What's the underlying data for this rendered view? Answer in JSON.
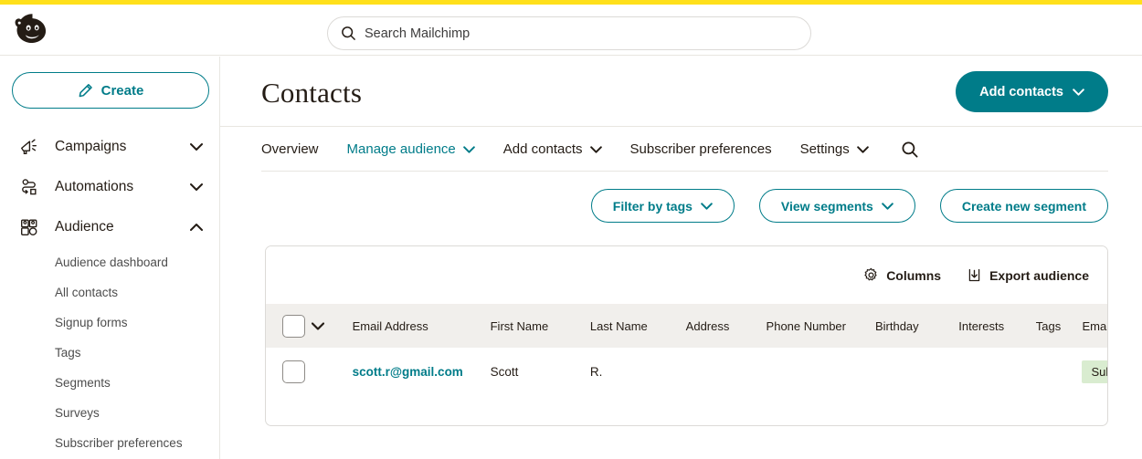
{
  "brand": {
    "logo_icon": "mailchimp-freddie-logo",
    "accent_color": "#007c89",
    "yellow_color": "#ffe01b",
    "badge_color": "#d9ecd0"
  },
  "header": {
    "search": {
      "icon": "search-icon",
      "placeholder": "Search Mailchimp",
      "value": ""
    }
  },
  "sidebar": {
    "create_button": {
      "label": "Create",
      "icon": "pencil-icon"
    },
    "nav": [
      {
        "label": "Campaigns",
        "icon": "megaphone-icon",
        "caret": "chevron-down-icon",
        "expanded": false
      },
      {
        "label": "Automations",
        "icon": "automation-flow-icon",
        "caret": "chevron-down-icon",
        "expanded": false
      },
      {
        "label": "Audience",
        "icon": "audience-people-icon",
        "caret": "chevron-up-icon",
        "expanded": true
      }
    ],
    "audience_subitems": [
      {
        "label": "Audience dashboard"
      },
      {
        "label": "All contacts"
      },
      {
        "label": "Signup forms"
      },
      {
        "label": "Tags"
      },
      {
        "label": "Segments"
      },
      {
        "label": "Surveys"
      },
      {
        "label": "Subscriber preferences"
      }
    ]
  },
  "page": {
    "title": "Contacts",
    "add_contacts_button": {
      "label": "Add contacts",
      "caret": "chevron-down-icon"
    }
  },
  "tabs": [
    {
      "label": "Overview",
      "active": false,
      "caret": null
    },
    {
      "label": "Manage audience",
      "active": true,
      "caret": "chevron-down-icon"
    },
    {
      "label": "Add contacts",
      "active": false,
      "caret": "chevron-down-icon"
    },
    {
      "label": "Subscriber preferences",
      "active": false,
      "caret": null
    },
    {
      "label": "Settings",
      "active": false,
      "caret": "chevron-down-icon"
    }
  ],
  "tab_search_icon": "search-icon",
  "filters": [
    {
      "label": "Filter by tags",
      "caret": "chevron-down-icon"
    },
    {
      "label": "View segments",
      "caret": "chevron-down-icon"
    },
    {
      "label": "Create new segment",
      "caret": null
    }
  ],
  "table_toolbar": [
    {
      "label": "Columns",
      "icon": "gear-icon"
    },
    {
      "label": "Export audience",
      "icon": "export-download-icon"
    }
  ],
  "table": {
    "select_all_checkbox": {
      "checked": false
    },
    "select_all_caret": "chevron-down-icon",
    "columns": [
      "Email Address",
      "First Name",
      "Last Name",
      "Address",
      "Phone Number",
      "Birthday",
      "Interests",
      "Tags",
      "Email Market"
    ],
    "rows": [
      {
        "checked": false,
        "email": "scott.r@gmail.com",
        "first_name": "Scott",
        "last_name": "R.",
        "address": "",
        "phone": "",
        "birthday": "",
        "interests": "",
        "tags": "",
        "email_marketing": "Subscribed"
      }
    ]
  }
}
